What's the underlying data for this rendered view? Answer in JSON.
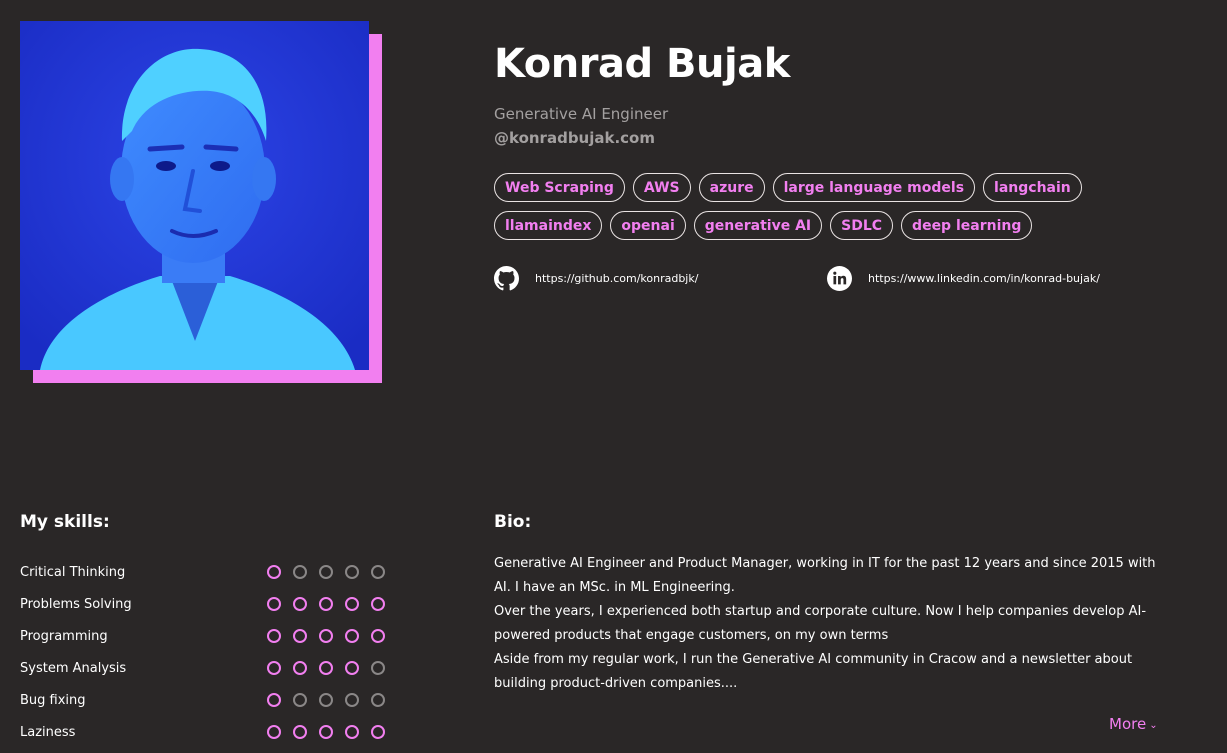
{
  "profile": {
    "name": "Konrad Bujak",
    "role": "Generative AI Engineer",
    "handle": "@konradbujak.com",
    "accent_color": "#f27ff0",
    "photo_tint": "#2438d6"
  },
  "tags": [
    "Web Scraping",
    "AWS",
    "azure",
    "large language models",
    "langchain",
    "llamaindex",
    "openai",
    "generative AI",
    "SDLC",
    "deep learning"
  ],
  "links": {
    "github": {
      "icon": "github-icon",
      "url": "https://github.com/konradbjk/"
    },
    "linkedin": {
      "icon": "linkedin-icon",
      "url": "https://www.linkedin.com/in/konrad-bujak/"
    }
  },
  "skills": {
    "title": "My skills:",
    "max_rating": 5,
    "items": [
      {
        "label": "Critical Thinking",
        "rating": 1
      },
      {
        "label": "Problems Solving",
        "rating": 5
      },
      {
        "label": "Programming",
        "rating": 5
      },
      {
        "label": "System Analysis",
        "rating": 4
      },
      {
        "label": "Bug fixing",
        "rating": 1
      },
      {
        "label": "Laziness",
        "rating": 5
      }
    ]
  },
  "bio": {
    "title": "Bio:",
    "paragraphs": [
      "Generative AI Engineer and Product Manager, working in IT for the past 12 years and since 2015 with AI. I have an MSc. in ML Engineering.",
      "Over the years, I experienced both startup and corporate culture. Now I help companies develop AI-powered products that engage customers, on my own terms",
      "Aside from my regular work, I run the Generative AI community in Cracow and a newsletter about building product-driven companies...."
    ],
    "more_label": "More",
    "more_icon": "chevron-down-icon"
  }
}
